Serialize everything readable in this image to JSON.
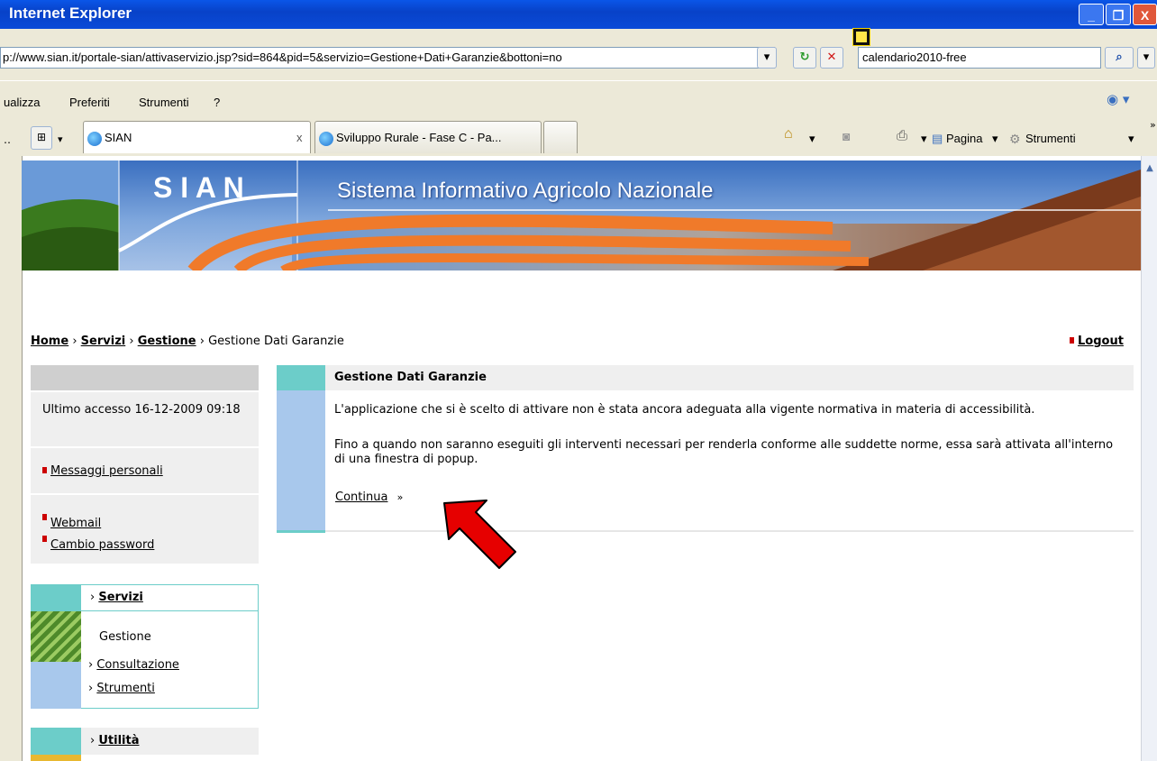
{
  "window": {
    "title": "Internet Explorer",
    "minimize": "_",
    "maximize": "❐",
    "close": "X"
  },
  "address_bar": {
    "url": "p://www.sian.it/portale-sian/attivaservizio.jsp?sid=864&pid=5&servizio=Gestione+Dati+Garanzie&bottoni=no",
    "search_value": "calendario2010-free"
  },
  "menu": {
    "items": [
      "ualizza",
      "Preferiti",
      "Strumenti",
      "?"
    ]
  },
  "tabs": {
    "items": [
      {
        "label": "SIAN",
        "close": "x"
      },
      {
        "label": "Sviluppo Rurale - Fase C - Pa..."
      }
    ]
  },
  "command_bar": {
    "page_label": "Pagina",
    "tools_label": "Strumenti"
  },
  "banner": {
    "logo": "S I A N",
    "subtitle": "Sistema Informativo Agricolo Nazionale"
  },
  "breadcrumb": {
    "items": [
      "Home",
      "Servizi",
      "Gestione",
      "Gestione Dati Garanzie"
    ],
    "separator": "›",
    "logout": "Logout"
  },
  "sidebar": {
    "last_access": "Ultimo accesso 16-12-2009 09:18",
    "personal_messages": "Messaggi personali",
    "links": [
      "Webmail",
      "Cambio password"
    ],
    "servizi": {
      "title": "Servizi",
      "current": "Gestione",
      "items": [
        "Consultazione",
        "Strumenti"
      ]
    },
    "utilita": {
      "title": "Utilità"
    }
  },
  "main": {
    "title": "Gestione Dati Garanzie",
    "paragraph1": "L'applicazione che si è scelto di attivare non è stata ancora adeguata alla vigente normativa in materia di accessibilità.",
    "paragraph2": "Fino a quando non saranno eseguiti gli interventi necessari per renderla conforme alle suddette norme, essa sarà attivata all'interno di una finestra di popup.",
    "continue_label": "Continua",
    "continue_icon": "»"
  },
  "colors": {
    "titlebar": "#0a4ad8",
    "chrome": "#ece9d8",
    "accent_teal": "#6ccdc9",
    "accent_blue": "#a8c8ec",
    "bullet_red": "#cc0000",
    "arrow_red": "#e60000"
  }
}
